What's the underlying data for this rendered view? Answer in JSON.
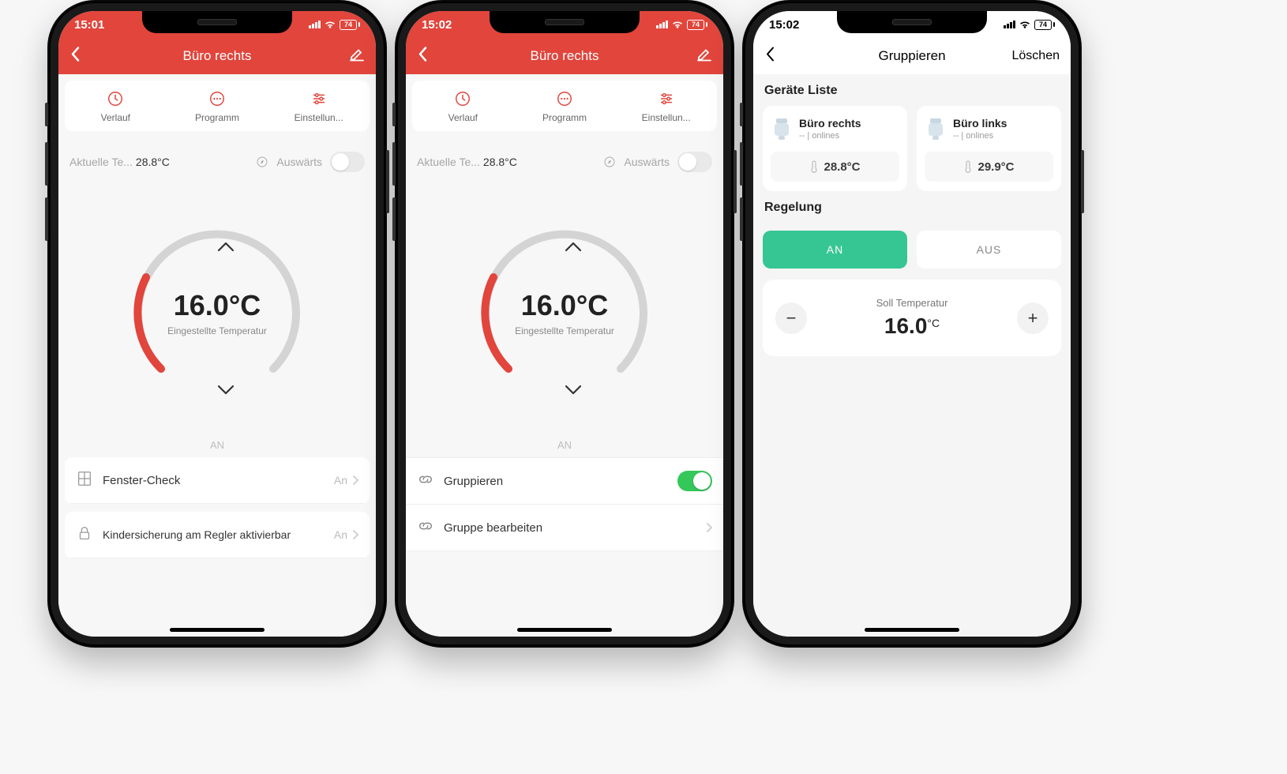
{
  "status": {
    "time1": "15:01",
    "time2": "15:02",
    "battery": "74"
  },
  "screen1": {
    "title": "Büro rechts",
    "tabs": {
      "history": "Verlauf",
      "program": "Programm",
      "settings": "Einstellun..."
    },
    "currentLabel": "Aktuelle Te...",
    "currentTemp": "28.8°C",
    "awayLabel": "Auswärts",
    "setTemp": "16.0°C",
    "setTempLabel": "Eingestellte Temperatur",
    "anLabel": "AN",
    "row1": {
      "label": "Fenster-Check",
      "value": "An"
    },
    "row2": {
      "label": "Kindersicherung am Regler aktivierbar",
      "value": "An"
    }
  },
  "screen2": {
    "title": "Büro rechts",
    "tabs": {
      "history": "Verlauf",
      "program": "Programm",
      "settings": "Einstellun..."
    },
    "currentLabel": "Aktuelle Te...",
    "currentTemp": "28.8°C",
    "awayLabel": "Auswärts",
    "setTemp": "16.0°C",
    "setTempLabel": "Eingestellte Temperatur",
    "anLabel": "AN",
    "rowGruppieren": "Gruppieren",
    "rowGruppeBearbeiten": "Gruppe bearbeiten"
  },
  "screen3": {
    "title": "Gruppieren",
    "action": "Löschen",
    "deviceListTitle": "Geräte Liste",
    "devices": [
      {
        "name": "Büro rechts",
        "status": "-- | onlines",
        "temp": "28.8°C"
      },
      {
        "name": "Büro links",
        "status": "-- | onlines",
        "temp": "29.9°C"
      }
    ],
    "controlTitle": "Regelung",
    "segOn": "AN",
    "segOff": "AUS",
    "sollLabel": "Soll Temperatur",
    "sollValue": "16.0",
    "sollUnit": "°C"
  }
}
